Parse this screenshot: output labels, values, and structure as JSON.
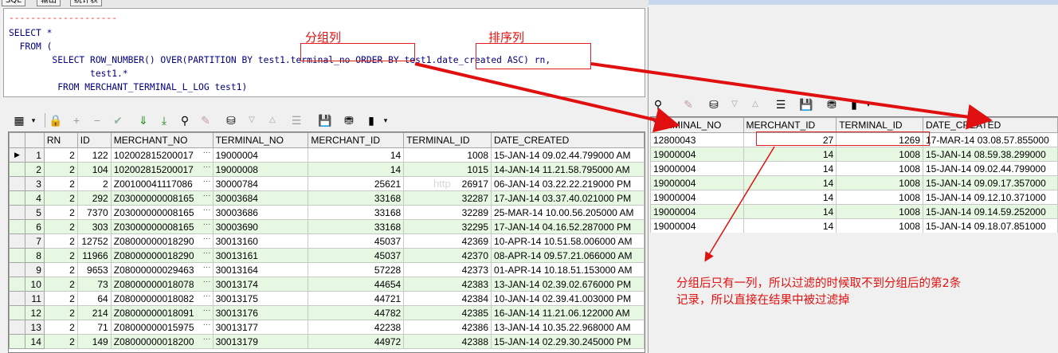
{
  "tabs": [
    "SQL",
    "输出",
    "统计表"
  ],
  "editor": {
    "dashes": "--------------------",
    "lines": [
      "SELECT *",
      "  FROM (",
      "        SELECT ROW_NUMBER() OVER(PARTITION BY test1.terminal_no ORDER BY test1.date_created ASC) rn,",
      "               test1.*",
      "         FROM MERCHANT_TERMINAL_L_LOG test1)"
    ],
    "label_partition": "分组列",
    "label_order": "排序列"
  },
  "grid_left": {
    "columns": [
      "RN",
      "ID",
      "MERCHANT_NO",
      "TERMINAL_NO",
      "MERCHANT_ID",
      "TERMINAL_ID",
      "DATE_CREATED"
    ],
    "rows": [
      [
        "1",
        "2",
        "122",
        "102002815200017",
        "19000004",
        "14",
        "1008",
        "15-JAN-14 09.02.44.799000 AM"
      ],
      [
        "2",
        "2",
        "104",
        "102002815200017",
        "19000008",
        "14",
        "1015",
        "14-JAN-14 11.21.58.795000 AM"
      ],
      [
        "3",
        "2",
        "2",
        "Z00100041117086",
        "30000784",
        "25621",
        "26917",
        "06-JAN-14 03.22.22.219000 PM"
      ],
      [
        "4",
        "2",
        "292",
        "Z03000000008165",
        "30003684",
        "33168",
        "32287",
        "17-JAN-14 03.37.40.021000 PM"
      ],
      [
        "5",
        "2",
        "7370",
        "Z03000000008165",
        "30003686",
        "33168",
        "32289",
        "25-MAR-14 10.00.56.205000 AM"
      ],
      [
        "6",
        "2",
        "303",
        "Z03000000008165",
        "30003690",
        "33168",
        "32295",
        "17-JAN-14 04.16.52.287000 PM"
      ],
      [
        "7",
        "2",
        "12752",
        "Z08000000018290",
        "30013160",
        "45037",
        "42369",
        "10-APR-14 10.51.58.006000 AM"
      ],
      [
        "8",
        "2",
        "11966",
        "Z08000000018290",
        "30013161",
        "45037",
        "42370",
        "08-APR-14 09.57.21.066000 AM"
      ],
      [
        "9",
        "2",
        "9653",
        "Z08000000029463",
        "30013164",
        "57228",
        "42373",
        "01-APR-14 10.18.51.153000 AM"
      ],
      [
        "10",
        "2",
        "73",
        "Z08000000018078",
        "30013174",
        "44654",
        "42383",
        "13-JAN-14 02.39.02.676000 PM"
      ],
      [
        "11",
        "2",
        "64",
        "Z08000000018082",
        "30013175",
        "44721",
        "42384",
        "10-JAN-14 02.39.41.003000 PM"
      ],
      [
        "12",
        "2",
        "214",
        "Z08000000018091",
        "30013176",
        "44782",
        "42385",
        "16-JAN-14 11.21.06.122000 AM"
      ],
      [
        "13",
        "2",
        "71",
        "Z08000000015975",
        "30013177",
        "42238",
        "42386",
        "13-JAN-14 10.35.22.968000 AM"
      ],
      [
        "14",
        "2",
        "149",
        "Z08000000018200",
        "30013179",
        "44972",
        "42388",
        "15-JAN-14 02.29.30.245000 PM"
      ]
    ]
  },
  "grid_right": {
    "columns": [
      "TERMINAL_NO",
      "MERCHANT_ID",
      "TERMINAL_ID",
      "DATE_CREATED"
    ],
    "rows": [
      [
        "12800043",
        "27",
        "1269",
        "17-MAR-14 03.08.57.855000"
      ],
      [
        "19000004",
        "14",
        "1008",
        "15-JAN-14 08.59.38.299000"
      ],
      [
        "19000004",
        "14",
        "1008",
        "15-JAN-14 09.02.44.799000"
      ],
      [
        "19000004",
        "14",
        "1008",
        "15-JAN-14 09.09.17.357000"
      ],
      [
        "19000004",
        "14",
        "1008",
        "15-JAN-14 09.12.10.371000"
      ],
      [
        "19000004",
        "14",
        "1008",
        "15-JAN-14 09.14.59.252000"
      ],
      [
        "19000004",
        "14",
        "1008",
        "15-JAN-14 09.18.07.851000"
      ]
    ]
  },
  "note": {
    "line1": "分组后只有一列，所以过滤的时候取不到分组后的第2条",
    "line2": "记录，所以直接在结果中被过滤掉"
  },
  "watermark": "http",
  "colors": {
    "annotation": "#e01010",
    "row_alt": "#e6f7e2",
    "sql_text": "#000080"
  }
}
